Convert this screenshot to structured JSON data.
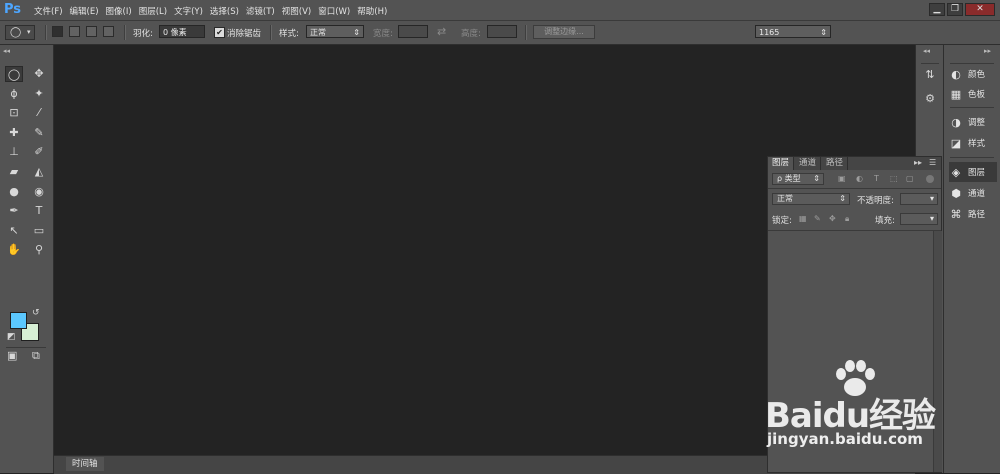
{
  "app": {
    "logo": "Ps"
  },
  "menu": [
    "文件(F)",
    "编辑(E)",
    "图像(I)",
    "图层(L)",
    "文字(Y)",
    "选择(S)",
    "滤镜(T)",
    "视图(V)",
    "窗口(W)",
    "帮助(H)"
  ],
  "window_controls": {
    "minimize": "▁",
    "restore": "❐",
    "close": "✕"
  },
  "options": {
    "feather_label": "羽化:",
    "feather_value": "0 像素",
    "antialias_label": "消除锯齿",
    "antialias_checked": "✔",
    "style_label": "样式:",
    "style_value": "正常",
    "width_label": "宽度:",
    "swap_icon": "⇄",
    "height_label": "高度:",
    "refine_edge_button": "调整边缘...",
    "workspace_value": "1165"
  },
  "toolbar": {
    "tools": [
      {
        "name": "marquee",
        "glyph": "◯",
        "active": true
      },
      {
        "name": "move",
        "glyph": "✥"
      },
      {
        "name": "lasso",
        "glyph": "ϕ"
      },
      {
        "name": "magic-wand",
        "glyph": "✦"
      },
      {
        "name": "crop",
        "glyph": "⊡"
      },
      {
        "name": "eyedropper",
        "glyph": "⁄"
      },
      {
        "name": "healing",
        "glyph": "✚"
      },
      {
        "name": "brush",
        "glyph": "✎"
      },
      {
        "name": "stamp",
        "glyph": "⊥"
      },
      {
        "name": "history-brush",
        "glyph": "✐"
      },
      {
        "name": "eraser",
        "glyph": "▰"
      },
      {
        "name": "bucket",
        "glyph": "◭"
      },
      {
        "name": "blur",
        "glyph": "●"
      },
      {
        "name": "dodge",
        "glyph": "◉"
      },
      {
        "name": "pen",
        "glyph": "✒"
      },
      {
        "name": "type",
        "glyph": "T"
      },
      {
        "name": "path-select",
        "glyph": "↖"
      },
      {
        "name": "shape",
        "glyph": "▭"
      },
      {
        "name": "hand",
        "glyph": "✋"
      },
      {
        "name": "zoom",
        "glyph": "⚲"
      }
    ],
    "foreground_color": "#5bc8ff",
    "background_color": "#d6efd4"
  },
  "right_strip_a": [
    {
      "name": "history",
      "glyph": "⇅"
    },
    {
      "name": "properties",
      "glyph": "⚙"
    }
  ],
  "panels": [
    {
      "label": "颜色",
      "glyph": "◐"
    },
    {
      "label": "色板",
      "glyph": "▦"
    },
    {
      "label": "调整",
      "glyph": "◑"
    },
    {
      "label": "样式",
      "glyph": "◪"
    },
    {
      "label": "图层",
      "glyph": "◈",
      "active": true
    },
    {
      "label": "通道",
      "glyph": "⬢"
    },
    {
      "label": "路径",
      "glyph": "⌘"
    }
  ],
  "layers_panel": {
    "tabs": [
      "图层",
      "通道",
      "路径"
    ],
    "kind_filter": "ρ 类型",
    "blend_mode": "正常",
    "opacity_label": "不透明度:",
    "lock_label": "锁定:",
    "fill_label": "填充:"
  },
  "timeline": {
    "tab_label": "时间轴"
  },
  "watermark": {
    "logo": "Baidu经验",
    "url": "jingyan.baidu.com"
  }
}
